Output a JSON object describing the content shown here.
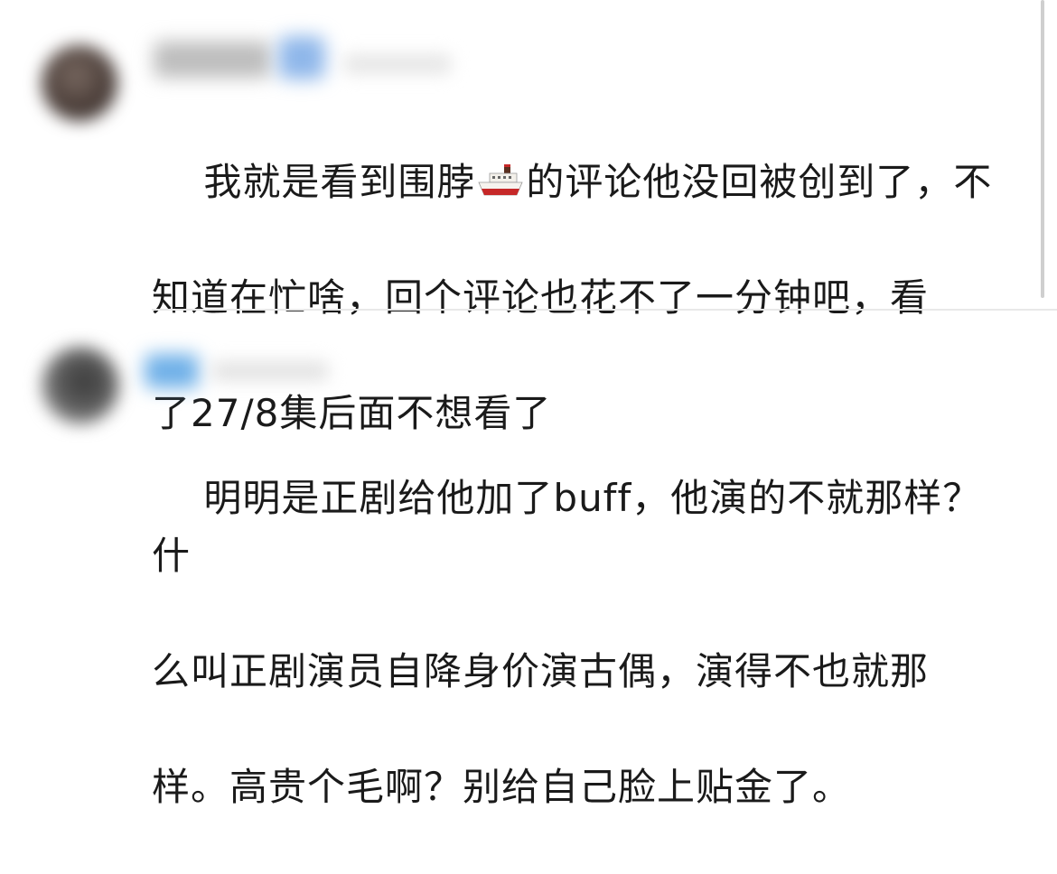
{
  "comments": [
    {
      "line1_before": "我就是看到围脖",
      "emoji": "ship-emoji",
      "line1_after": "的评论他没回被创到了，不",
      "line2": "知道在忙啥，回个评论也花不了一分钟吧，看",
      "line3": "了27/8集后面不想看了"
    },
    {
      "line1": "明明是正剧给他加了buff，他演的不就那样？什",
      "line2": "么叫正剧演员自降身价演古偶，演得不也就那",
      "line3": "样。高贵个毛啊？别给自己脸上贴金了。"
    }
  ],
  "colors": {
    "text": "#1a1a1a",
    "divider": "#e8e8e8",
    "badge_blue": "#4a90d9"
  }
}
